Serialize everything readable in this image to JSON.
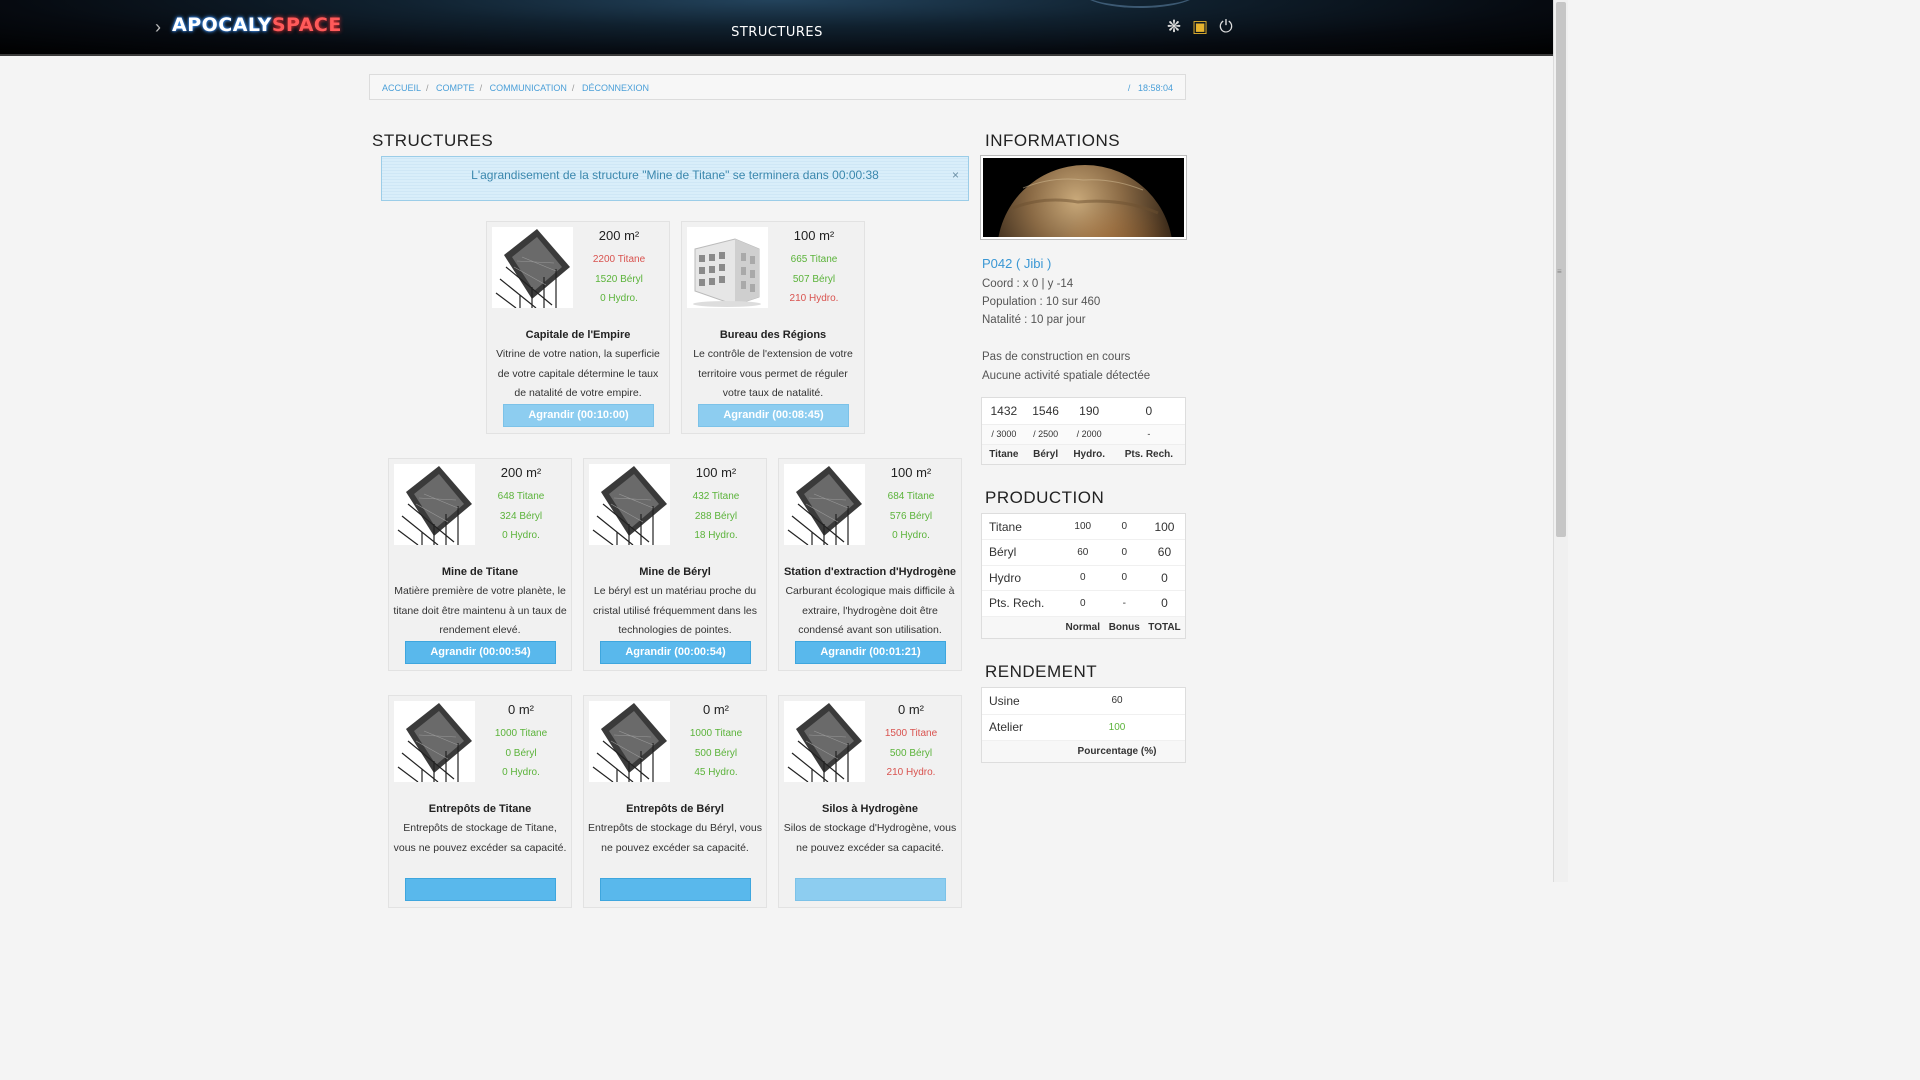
{
  "app": {
    "logo_part1": "APOCALY",
    "logo_part2": "SPACE",
    "page_title": "STRUCTURES"
  },
  "header_icons": [
    "settings-icon",
    "gift-icon",
    "power-icon"
  ],
  "breadcrumb": {
    "items": [
      "ACCUEIL",
      "COMPTE",
      "COMMUNICATION",
      "DÉCONNEXION"
    ],
    "time_sep": "/",
    "time": "18:58:04"
  },
  "structures": {
    "title": "STRUCTURES",
    "alert": "L'agrandisement de la structure \"Mine de Titane\" se terminera dans 00:00:38",
    "alert_close": "×",
    "cards": [
      {
        "area": "200 m²",
        "costs": [
          {
            "text": "2200 Titane",
            "status": "bad"
          },
          {
            "text": "1520 Béryl",
            "status": "ok"
          },
          {
            "text": "0 Hydro.",
            "status": "ok"
          }
        ],
        "name": "Capitale de l'Empire",
        "desc": "Vitrine de votre nation, la superficie de votre capitale détermine le taux de natalité de votre empire.",
        "button": "Agrandir (00:10:00)",
        "button_state": "disabled",
        "image": "structure-icon"
      },
      {
        "area": "100 m²",
        "costs": [
          {
            "text": "665 Titane",
            "status": "ok"
          },
          {
            "text": "507 Béryl",
            "status": "ok"
          },
          {
            "text": "210 Hydro.",
            "status": "bad"
          }
        ],
        "name": "Bureau des Régions",
        "desc": "Le contrôle de l'extension de votre territoire vous permet de réguler votre taux de natalité.",
        "button": "Agrandir (00:08:45)",
        "button_state": "disabled",
        "image": "building-icon"
      },
      {
        "area": "200 m²",
        "costs": [
          {
            "text": "648 Titane",
            "status": "ok"
          },
          {
            "text": "324 Béryl",
            "status": "ok"
          },
          {
            "text": "0 Hydro.",
            "status": "ok"
          }
        ],
        "name": "Mine de Titane",
        "desc": "Matière première de votre planète, le titane doit être maintenu à un taux de rendement elevé.",
        "button": "Agrandir (00:00:54)",
        "button_state": "enabled",
        "image": "structure-icon"
      },
      {
        "area": "100 m²",
        "costs": [
          {
            "text": "432 Titane",
            "status": "ok"
          },
          {
            "text": "288 Béryl",
            "status": "ok"
          },
          {
            "text": "18 Hydro.",
            "status": "ok"
          }
        ],
        "name": "Mine de Béryl",
        "desc": "Le béryl est un matériau proche du cristal utilisé fréquemment dans les technologies de pointes.",
        "button": "Agrandir (00:00:54)",
        "button_state": "enabled",
        "image": "structure-icon"
      },
      {
        "area": "100 m²",
        "costs": [
          {
            "text": "684 Titane",
            "status": "ok"
          },
          {
            "text": "576 Béryl",
            "status": "ok"
          },
          {
            "text": "0 Hydro.",
            "status": "ok"
          }
        ],
        "name": "Station d'extraction d'Hydrogène",
        "desc": "Carburant écologique mais difficile à extraire, l'hydrogène doit être condensé avant son utilisation.",
        "button": "Agrandir (00:01:21)",
        "button_state": "enabled",
        "image": "structure-icon"
      },
      {
        "area": "0 m²",
        "costs": [
          {
            "text": "1000 Titane",
            "status": "ok"
          },
          {
            "text": "0 Béryl",
            "status": "ok"
          },
          {
            "text": "0 Hydro.",
            "status": "ok"
          }
        ],
        "name": "Entrepôts de Titane",
        "desc": "Entrepôts de stockage de Titane, vous ne pouvez excéder sa capacité.",
        "button": "",
        "button_state": "enabled",
        "image": "structure-icon"
      },
      {
        "area": "0 m²",
        "costs": [
          {
            "text": "1000 Titane",
            "status": "ok"
          },
          {
            "text": "500 Béryl",
            "status": "ok"
          },
          {
            "text": "45 Hydro.",
            "status": "ok"
          }
        ],
        "name": "Entrepôts de Béryl",
        "desc": "Entrepôts de stockage du Béryl, vous ne pouvez excéder sa capacité.",
        "button": "",
        "button_state": "enabled",
        "image": "structure-icon"
      },
      {
        "area": "0 m²",
        "costs": [
          {
            "text": "1500 Titane",
            "status": "bad"
          },
          {
            "text": "500 Béryl",
            "status": "ok"
          },
          {
            "text": "210 Hydro.",
            "status": "bad"
          }
        ],
        "name": "Silos à Hydrogène",
        "desc": "Silos de stockage d'Hydrogène, vous ne pouvez excéder sa capacité.",
        "button": "",
        "button_state": "disabled",
        "image": "structure-icon"
      }
    ]
  },
  "info": {
    "title": "INFORMATIONS",
    "planet": "P042 ( Jibi )",
    "coord": "Coord : x 0 | y -14",
    "population": "Population : 10 sur 460",
    "natalite": "Natalité : 10 par jour",
    "construction": "Pas de construction en cours",
    "activity": "Aucune activité spatiale détectée",
    "resources": {
      "values": [
        "1432",
        "1546",
        "190",
        "0"
      ],
      "max": [
        "/ 3000",
        "/ 2500",
        "/ 2000",
        "-"
      ],
      "labels": [
        "Titane",
        "Béryl",
        "Hydro.",
        "Pts. Rech."
      ]
    }
  },
  "production": {
    "title": "PRODUCTION",
    "rows": [
      {
        "label": "Titane",
        "normal": "100",
        "bonus": "0",
        "total": "100"
      },
      {
        "label": "Béryl",
        "normal": "60",
        "bonus": "0",
        "total": "60"
      },
      {
        "label": "Hydro",
        "normal": "0",
        "bonus": "0",
        "total": "0"
      },
      {
        "label": "Pts. Rech.",
        "normal": "0",
        "bonus": "-",
        "total": "0"
      }
    ],
    "columns": [
      "Normal",
      "Bonus",
      "TOTAL"
    ]
  },
  "rendement": {
    "title": "RENDEMENT",
    "rows": [
      {
        "label": "Usine",
        "value": "60",
        "status": "normal"
      },
      {
        "label": "Atelier",
        "value": "100",
        "status": "ok"
      }
    ],
    "footer": "Pourcentage (%)"
  },
  "colors": {
    "accent": "#59b8ec",
    "ok": "#5bb33a",
    "bad": "#d9534f",
    "link": "#4a9fd8"
  }
}
